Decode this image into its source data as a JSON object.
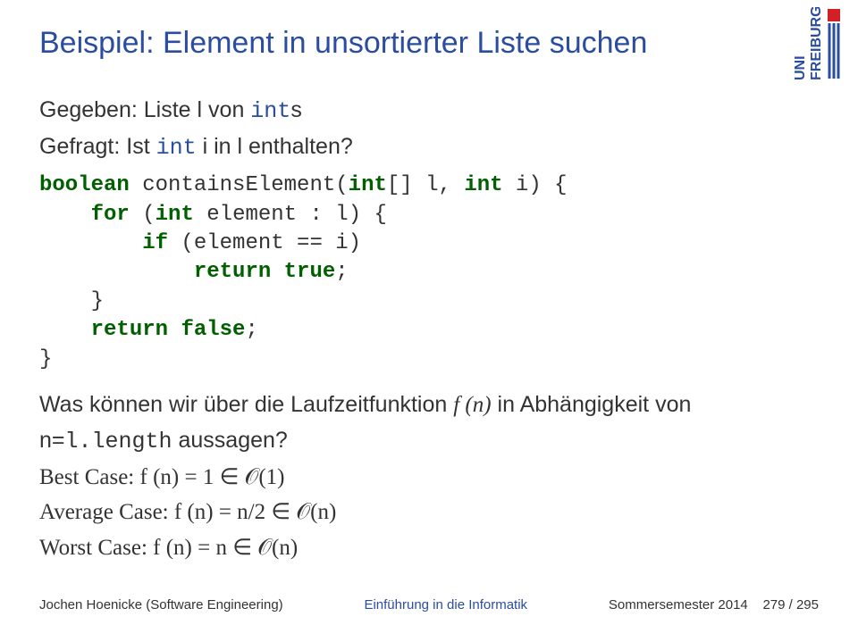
{
  "title": "Beispiel: Element in unsortierter Liste suchen",
  "given": {
    "label": "Gegeben:",
    "prefix": "Liste l von ",
    "type": "int",
    "suffix": "s"
  },
  "asked": {
    "label": "Gefragt:",
    "prefix": "Ist ",
    "type": "int",
    "rest": " i in l enthalten?"
  },
  "code": {
    "l1_type1": "boolean",
    "l1_name": " containsElement(",
    "l1_type2": "int",
    "l1_after_type2": "[] l, ",
    "l1_type3": "int",
    "l1_after_type3": " i) {",
    "l2_for": "for",
    "l2_open": " (",
    "l2_type": "int",
    "l2_rest": " element : l) {",
    "l3_if": "if",
    "l3_rest": " (element == i)",
    "l4_ret": "return",
    "l4_sp": " ",
    "l4_true": "true",
    "l4_semi": ";",
    "l5": "    }",
    "l6_ret": "return",
    "l6_sp": " ",
    "l6_false": "false",
    "l6_semi": ";",
    "l7": "}"
  },
  "question": {
    "pre": "Was können wir über die Laufzeitfunktion ",
    "fn": "f (n)",
    "mid": " in Abhängigkeit von",
    "line2_pre": "n=",
    "line2_tt": "l.length",
    "line2_post": " aussagen?"
  },
  "cases": {
    "best": "Best Case: f (n) = 1 ∈ 𝒪(1)",
    "avg": "Average Case: f (n) = n/2 ∈ 𝒪(n)",
    "worst": "Worst Case: f (n) = n ∈ 𝒪(n)"
  },
  "footer": {
    "author": "Jochen Hoenicke (Software Engineering)",
    "course": "Einführung in die Informatik",
    "term": "Sommersemester 2014",
    "page": "279 / 295"
  },
  "logo": {
    "name": "uni-freiburg-logo",
    "text_top": "UNI",
    "text_bottom": "FREIBURG",
    "accent": "#d22027",
    "fg": "#2a4da0"
  }
}
